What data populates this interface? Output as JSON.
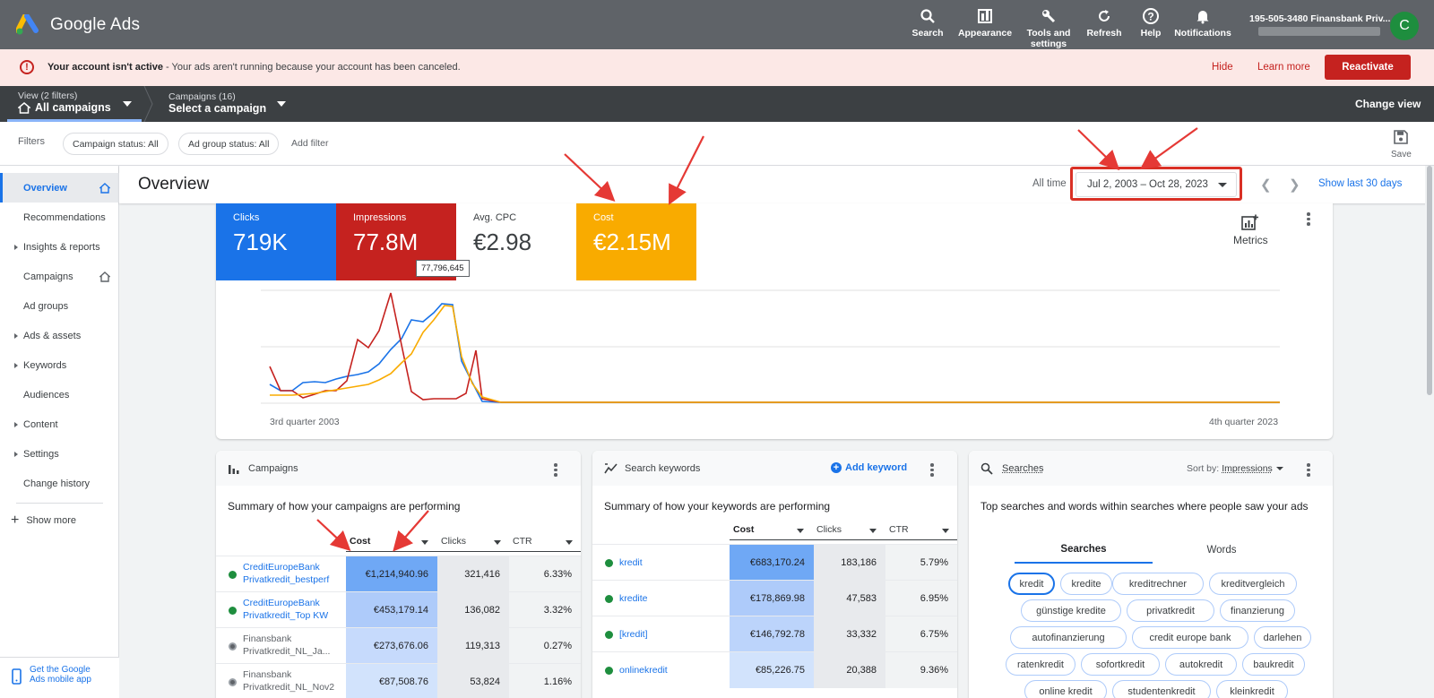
{
  "topbar": {
    "app_name": "Google Ads",
    "actions": [
      {
        "label": "Search",
        "icon": "search-icon"
      },
      {
        "label": "Appearance",
        "icon": "appearance-icon"
      },
      {
        "label": "Tools and settings",
        "icon": "wrench-icon"
      },
      {
        "label": "Refresh",
        "icon": "refresh-icon"
      },
      {
        "label": "Help",
        "icon": "help-icon"
      },
      {
        "label": "Notifications",
        "icon": "bell-icon"
      }
    ],
    "account_name": "195-505-3480 Finansbank Priv...",
    "avatar_letter": "C"
  },
  "alert": {
    "title": "Your account isn't active",
    "message": " - Your ads aren't running because your account has been canceled.",
    "hide": "Hide",
    "learn_more": "Learn more",
    "reactivate": "Reactivate"
  },
  "viewbar": {
    "view_small": "View (2 filters)",
    "view_large": "All campaigns",
    "campaigns_small": "Campaigns (16)",
    "campaigns_large": "Select a campaign",
    "change_view": "Change view"
  },
  "filterbar": {
    "label": "Filters",
    "chips": [
      "Campaign status: All",
      "Ad group status: All"
    ],
    "add_filter": "Add filter",
    "save": "Save"
  },
  "sidebar": {
    "items": [
      {
        "label": "Overview",
        "active": true,
        "expand": false,
        "home": true
      },
      {
        "label": "Recommendations",
        "expand": false
      },
      {
        "label": "Insights & reports",
        "expand": true
      },
      {
        "label": "Campaigns",
        "expand": false,
        "home": true
      },
      {
        "label": "Ad groups",
        "expand": false
      },
      {
        "label": "Ads & assets",
        "expand": true
      },
      {
        "label": "Keywords",
        "expand": true
      },
      {
        "label": "Audiences",
        "expand": false
      },
      {
        "label": "Content",
        "expand": true
      },
      {
        "label": "Settings",
        "expand": true
      },
      {
        "label": "Change history",
        "expand": false
      }
    ],
    "show_more": "Show more",
    "mobile_app_line1": "Get the Google",
    "mobile_app_line2": "Ads mobile app"
  },
  "overview": {
    "title": "Overview",
    "all_time": "All time",
    "date_range": "Jul 2, 2003 – Oct 28, 2023",
    "show_last": "Show last 30 days",
    "metrics_label": "Metrics",
    "tiles": [
      {
        "label": "Clicks",
        "value": "719K",
        "bg": "#1a73e8",
        "fg": "#ffffff"
      },
      {
        "label": "Impressions",
        "value": "77.8M",
        "bg": "#c5221f",
        "fg": "#ffffff"
      },
      {
        "label": "Avg. CPC",
        "value": "€2.98",
        "bg": "#ffffff",
        "fg": "#3c4043"
      },
      {
        "label": "Cost",
        "value": "€2.15M",
        "bg": "#f9ab00",
        "fg": "#ffffff"
      }
    ],
    "tooltip": "77,796,645",
    "x_start": "3rd quarter 2003",
    "x_end": "4th quarter 2023"
  },
  "campaigns_card": {
    "title": "Campaigns",
    "subtitle": "Summary of how your campaigns are performing",
    "columns": [
      "Cost",
      "Clicks",
      "CTR"
    ],
    "rows": [
      {
        "name1": "CreditEuropeBank",
        "name2": "Privatkredit_bestperf",
        "status": "active",
        "cost": "€1,214,940.96",
        "clicks": "321,416",
        "ctr": "6.33%",
        "shade": "#6fa8f5"
      },
      {
        "name1": "CreditEuropeBank",
        "name2": "Privatkredit_Top KW",
        "status": "active",
        "cost": "€453,179.14",
        "clicks": "136,082",
        "ctr": "3.32%",
        "shade": "#aecbfa"
      },
      {
        "name1": "Finansbank",
        "name2": "Privatkredit_NL_Ja...",
        "status": "paused",
        "cost": "€273,676.06",
        "clicks": "119,313",
        "ctr": "0.27%",
        "shade": "#c6dafc"
      },
      {
        "name1": "Finansbank",
        "name2": "Privatkredit_NL_Nov2",
        "status": "paused",
        "cost": "€87,508.76",
        "clicks": "53,824",
        "ctr": "1.16%",
        "shade": "#d2e3fc"
      }
    ]
  },
  "keywords_card": {
    "title": "Search keywords",
    "add_keyword": "Add keyword",
    "subtitle": "Summary of how your keywords are performing",
    "columns": [
      "Cost",
      "Clicks",
      "CTR"
    ],
    "rows": [
      {
        "name": "kredit",
        "cost": "€683,170.24",
        "clicks": "183,186",
        "ctr": "5.79%",
        "shade": "#6fa8f5"
      },
      {
        "name": "kredite",
        "cost": "€178,869.98",
        "clicks": "47,583",
        "ctr": "6.95%",
        "shade": "#aecbfa"
      },
      {
        "name": "[kredit]",
        "cost": "€146,792.78",
        "clicks": "33,332",
        "ctr": "6.75%",
        "shade": "#bcd4fb"
      },
      {
        "name": "onlinekredit",
        "cost": "€85,226.75",
        "clicks": "20,388",
        "ctr": "9.36%",
        "shade": "#d2e3fc"
      }
    ]
  },
  "searches_card": {
    "title": "Searches",
    "sort_by": "Sort by:",
    "sort_value": "Impressions",
    "subtitle": "Top searches and words within searches where people saw your ads",
    "tabs": [
      "Searches",
      "Words"
    ],
    "terms": [
      "kredit",
      "kredite",
      "kreditrechner",
      "kreditvergleich",
      "günstige kredite",
      "privatkredit",
      "finanzierung",
      "autofinanzierung",
      "credit europe bank",
      "darlehen",
      "ratenkredit",
      "sofortkredit",
      "autokredit",
      "baukredit",
      "online kredit",
      "studentenkredit",
      "kleinkredit"
    ]
  },
  "colors": {
    "clicks_line": "#1a73e8",
    "impressions_line": "#c5221f",
    "cost_line": "#f9ab00",
    "annotation": "#d93025"
  }
}
